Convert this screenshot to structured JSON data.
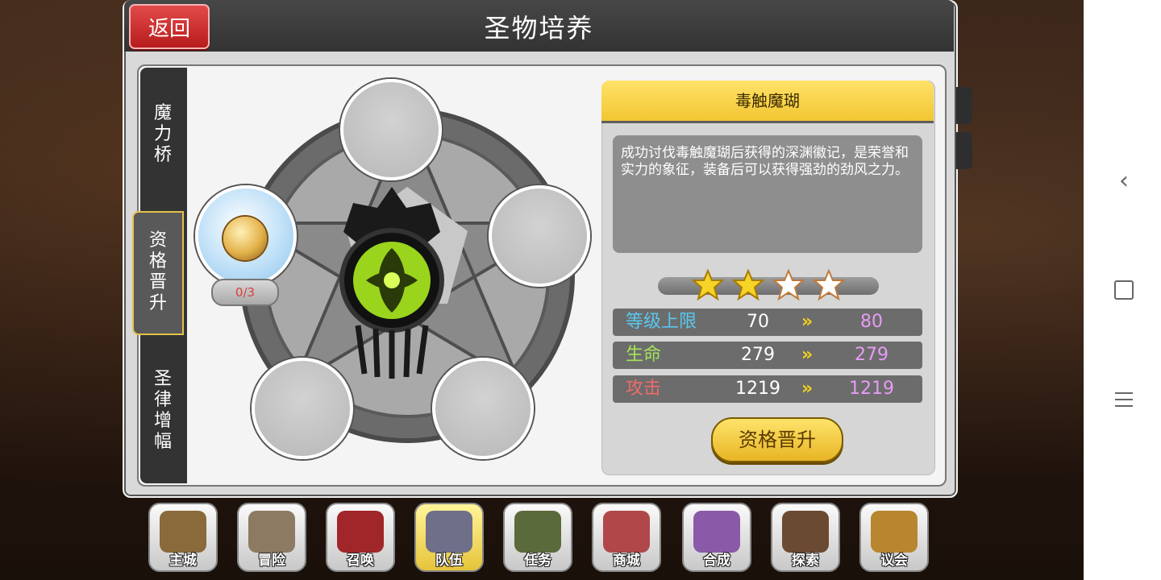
{
  "window": {
    "title": "圣物培养"
  },
  "header": {
    "back_label": "返回"
  },
  "side_tabs": [
    {
      "label": [
        "魔",
        "力",
        "桥"
      ]
    },
    {
      "label": [
        "资",
        "格",
        "晋",
        "升"
      ],
      "active": true
    },
    {
      "label": [
        "圣",
        "律",
        "增",
        "幅"
      ]
    }
  ],
  "material": {
    "count": "0/3"
  },
  "relic": {
    "name": "毒触魔瑚",
    "description": "成功讨伐毒触魔瑚后获得的深渊徽记，是荣誉和实力的象征，装备后可以获得强劲的劲风之力。",
    "stars_filled": 2,
    "stars_total": 4
  },
  "stats": [
    {
      "label": "等级上限",
      "current": "70",
      "next": "80",
      "color": "#59c7f0"
    },
    {
      "label": "生命",
      "current": "279",
      "next": "279",
      "color": "#a6e35a"
    },
    {
      "label": "攻击",
      "current": "1219",
      "next": "1219",
      "color": "#f06a6a"
    }
  ],
  "stat_arrow": "»",
  "promote_button": "资格晋升",
  "dock": [
    {
      "label": "主城",
      "icon": "crown-icon",
      "color": "#8a6a3a"
    },
    {
      "label": "冒险",
      "icon": "crossed-swords-icon",
      "color": "#8c7a62"
    },
    {
      "label": "召唤",
      "icon": "summon-card-icon",
      "color": "#a1262a"
    },
    {
      "label": "队伍",
      "icon": "winged-crest-icon",
      "color": "#6f6f8a",
      "active": true
    },
    {
      "label": "任务",
      "icon": "quest-book-icon",
      "color": "#5b6a3a"
    },
    {
      "label": "商城",
      "icon": "shop-tree-icon",
      "color": "#b0484a"
    },
    {
      "label": "合成",
      "icon": "potion-flask-icon",
      "color": "#8a5aa8"
    },
    {
      "label": "探索",
      "icon": "explore-shovel-icon",
      "color": "#6b4a32"
    },
    {
      "label": "议会",
      "icon": "council-emblem-icon",
      "color": "#b8862e"
    }
  ],
  "colors": {
    "accent": "#f2c631",
    "panel": "#d9d9d9",
    "header": "#3d3d3d"
  }
}
